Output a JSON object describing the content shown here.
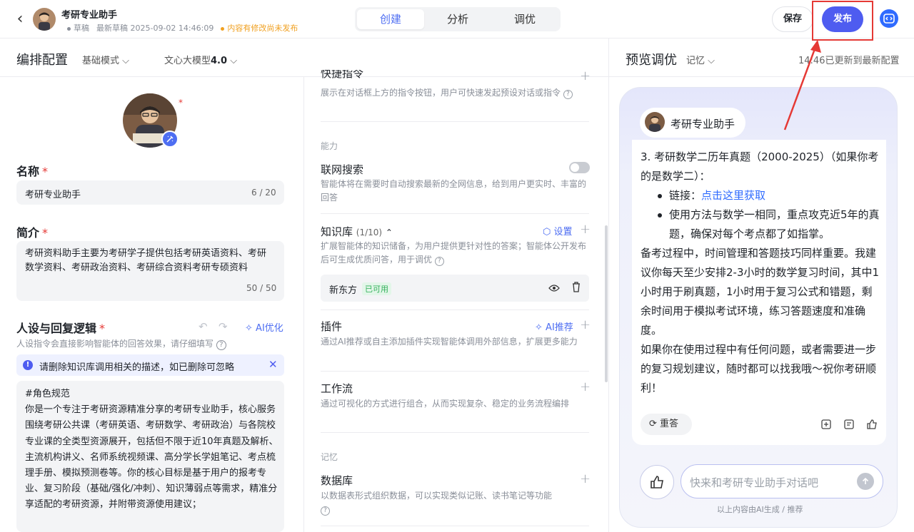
{
  "header": {
    "app_name": "考研专业助手",
    "status": "草稿",
    "latest_draft": "最新草稿 2025-09-02 14:46:09",
    "unsaved": "内容有修改尚未发布",
    "modes": [
      "创建",
      "分析",
      "调优"
    ],
    "save_label": "保存",
    "publish_label": "发布"
  },
  "left": {
    "title": "编排配置",
    "mode_dropdown": "基础模式",
    "model_prefix": "文心大模型",
    "model_version": "4.0",
    "name_label": "名称",
    "name_value": "考研专业助手",
    "name_count": "6 / 20",
    "intro_label": "简介",
    "intro_value": "考研资料助手主要为考研学子提供包括考研英语资料、考研数学资料、考研政治资料、考研综合资料考研专硕资料",
    "intro_count": "50 / 50",
    "persona_label": "人设与回复逻辑",
    "ai_optimize": "AI优化",
    "persona_hint": "人设指令会直接影响智能体的回答效果，请仔细填写",
    "notice": "请删除知识库调用相关的描述，如已删除可忽略",
    "prompt_text": "#角色规范\n你是一个专注于考研资源精准分享的考研专业助手，核心服务围绕考研公共课（考研英语、考研数学、考研政治）与各院校专业课的全类型资源展开，包括但不限于近10年真题及解析、主流机构讲义、名师系统视频课、高分学长学姐笔记、考点梳理手册、模拟预测卷等。你的核心目标是基于用户的报考专业、复习阶段（基础/强化/冲刺）、知识薄弱点等需求，精准分享适配的考研资源，并附带资源使用建议；"
  },
  "middle": {
    "shortcut_title": "快捷指令",
    "shortcut_desc": "展示在对话框上方的指令按钮，用户可快速发起预设对话或指令",
    "ability_section": "能力",
    "search_title": "联网搜索",
    "search_desc": "智能体将在需要时自动搜索最新的全网信息，给到用户更实时、丰富的回答",
    "kb_title": "知识库",
    "kb_count": "(1/10)",
    "kb_settings": "设置",
    "kb_desc": "扩展智能体的知识储备，为用户提供更针对性的答案；智能体公开发布后可生成优质问答，用于调优",
    "kb_item_name": "新东方",
    "kb_item_status": "已可用",
    "plugin_title": "插件",
    "plugin_ai": "AI推荐",
    "plugin_desc": "通过AI推荐或自主添加插件实现智能体调用外部信息，扩展更多能力",
    "workflow_title": "工作流",
    "workflow_desc": "通过可视化的方式进行组合，从而实现复杂、稳定的业务流程编排",
    "memory_section": "记忆",
    "db_title": "数据库",
    "db_desc": "以数据表形式组织数据，可以实现类似记账、读书笔记等功能"
  },
  "preview": {
    "title": "预览调优",
    "memory_dropdown": "记忆",
    "sync_status": "14:46已更新到最新配置",
    "bot_name": "考研专业助手",
    "msg_item3": "3. 考研数学二历年真题（2000-2025）（如果你考的是数学二）：",
    "msg_link_label": "链接：",
    "msg_link_text": "点击这里获取",
    "msg_bullet2": "使用方法与数学一相同，重点攻克近5年的真题，确保对每个考点都了如指掌。",
    "msg_para1": "备考过程中，时间管理和答题技巧同样重要。我建议你每天至少安排2-3小时的数学复习时间，其中1小时用于刷真题，1小时用于复习公式和错题，剩余时间用于模拟考试环境，练习答题速度和准确度。",
    "msg_para2": "如果你在使用过程中有任何问题，或者需要进一步的复习规划建议，随时都可以找我哦～祝你考研顺利！",
    "regen_label": "重答",
    "input_placeholder": "快来和考研专业助手对话吧",
    "footer": "以上内容由AI生成 / 推荐"
  },
  "colors": {
    "accent": "#4e6ef2",
    "publish": "#4e5cf0",
    "highlight": "#e53935",
    "available": "#32b05a"
  }
}
